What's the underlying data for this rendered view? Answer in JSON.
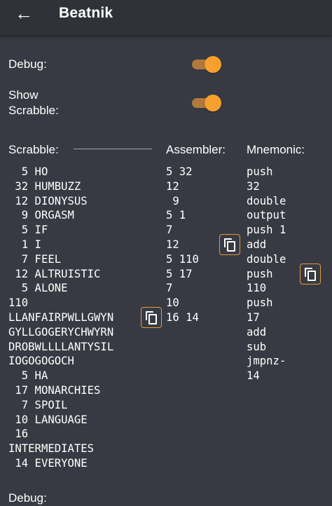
{
  "app_bar": {
    "back_icon": "arrow-left-icon",
    "title": "Beatnik"
  },
  "settings": {
    "debug_label": "Debug:",
    "debug_on": true,
    "show_scrabble_line1": "Show",
    "show_scrabble_line2": "Scrabble:",
    "show_scrabble_on": true,
    "accent_color": "#f6a12e"
  },
  "headers": {
    "scrabble": "Scrabble:",
    "assembler": "Assembler:",
    "mnemonic": "Mnemonic:"
  },
  "scrabble_text": "  5 HO\n 32 HUMBUZZ\n 12 DIONYSUS\n  9 ORGASM\n  5 IF\n  1 I\n  7 FEEL\n 12 ALTRUISTIC\n  5 ALONE\n110\nLLANFAIRPWLLGWYN\nGYLLGOGERYCHWYRN\nDROBWLLLLANTYSIL\nIOGOGOGOCH\n  5 HA\n 17 MONARCHIES\n  7 SPOIL\n 10 LANGUAGE\n 16\nINTERMEDIATES\n 14 EVERYONE",
  "assembler_text": "5 32\n12\n 9\n5 1\n7\n12\n5 110\n5 17\n7\n10\n16 14",
  "mnemonic_text": "push\n32\ndouble\noutput\npush 1\nadd\ndouble\npush\n110\npush\n17\nadd\nsub\njmpnz-\n14",
  "copy_icon": "copy-icon",
  "footer_partial_label": "Debug:"
}
